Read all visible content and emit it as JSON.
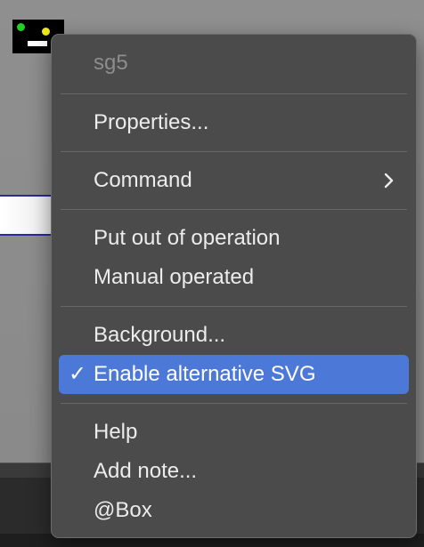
{
  "context_menu": {
    "header": "sg5",
    "groups": [
      {
        "items": [
          {
            "label": "Properties..."
          }
        ]
      },
      {
        "items": [
          {
            "label": "Command",
            "submenu_icon": "chevron-right-icon"
          }
        ]
      },
      {
        "items": [
          {
            "label": "Put out of operation"
          },
          {
            "label": "Manual operated"
          }
        ]
      },
      {
        "items": [
          {
            "label": "Background..."
          },
          {
            "label": "Enable alternative SVG",
            "checked": true,
            "highlighted": true,
            "check_glyph": "✓"
          }
        ]
      },
      {
        "items": [
          {
            "label": "Help"
          },
          {
            "label": "Add note..."
          },
          {
            "label": "@Box"
          }
        ]
      }
    ],
    "highlight_color": "#4c79d8",
    "background_color": "#4b4b4b"
  },
  "device_icon": {
    "icon": "switchgear-device-icon",
    "led_colors": [
      "#22d022",
      "#f2ea1c"
    ]
  }
}
